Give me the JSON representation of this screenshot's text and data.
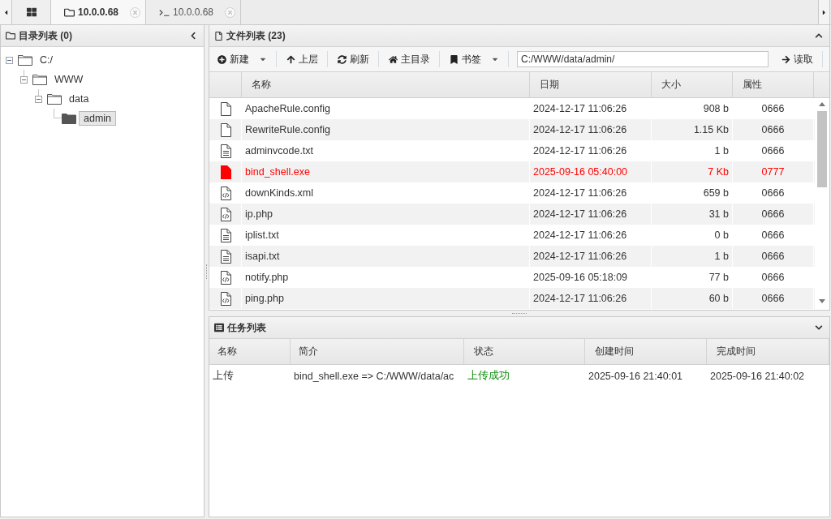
{
  "tabs": [
    {
      "label": "10.0.0.68",
      "kind": "files",
      "selected": true
    },
    {
      "label": "10.0.0.68",
      "kind": "terminal",
      "selected": false
    }
  ],
  "directory_panel": {
    "title": "目录列表 (0)",
    "tree": [
      {
        "label": "C:/",
        "expanded": true,
        "selected": false,
        "children": [
          {
            "label": "WWW",
            "expanded": true,
            "selected": false,
            "children": [
              {
                "label": "data",
                "expanded": true,
                "selected": false,
                "children": [
                  {
                    "label": "admin",
                    "selected": true
                  }
                ]
              }
            ]
          }
        ]
      }
    ]
  },
  "file_panel": {
    "title": "文件列表 (23)",
    "toolbar": [
      {
        "label": "新建",
        "kind": "new",
        "dropdown": true
      },
      {
        "label": "上层",
        "kind": "up",
        "dropdown": false
      },
      {
        "label": "刷新",
        "kind": "refresh",
        "dropdown": false
      },
      {
        "label": "主目录",
        "kind": "home",
        "dropdown": false
      },
      {
        "label": "书签",
        "kind": "bookmark",
        "dropdown": true
      }
    ],
    "path_field": {
      "value": "C:/WWW/data/admin/"
    },
    "read_button": {
      "label": "读取"
    },
    "table": {
      "columns": [
        "名称",
        "日期",
        "大小",
        "属性"
      ],
      "rows": [
        {
          "kind": "blank",
          "name": "ApacheRule.config",
          "date": "2024-12-17 11:06:26",
          "size": "908 b",
          "mode": "0666",
          "highlighted": false
        },
        {
          "kind": "blank",
          "name": "RewriteRule.config",
          "date": "2024-12-17 11:06:26",
          "size": "1.15 Kb",
          "mode": "0666",
          "highlighted": false
        },
        {
          "kind": "text",
          "name": "adminvcode.txt",
          "date": "2024-12-17 11:06:26",
          "size": "1 b",
          "mode": "0666",
          "highlighted": false
        },
        {
          "kind": "executable",
          "name": "bind_shell.exe",
          "date": "2025-09-16 05:40:00",
          "size": "7 Kb",
          "mode": "0777",
          "highlighted": true
        },
        {
          "kind": "code",
          "name": "downKinds.xml",
          "date": "2024-12-17 11:06:26",
          "size": "659 b",
          "mode": "0666",
          "highlighted": false
        },
        {
          "kind": "code",
          "name": "ip.php",
          "date": "2024-12-17 11:06:26",
          "size": "31 b",
          "mode": "0666",
          "highlighted": false
        },
        {
          "kind": "text",
          "name": "iplist.txt",
          "date": "2024-12-17 11:06:26",
          "size": "0 b",
          "mode": "0666",
          "highlighted": false
        },
        {
          "kind": "text",
          "name": "isapi.txt",
          "date": "2024-12-17 11:06:26",
          "size": "1 b",
          "mode": "0666",
          "highlighted": false
        },
        {
          "kind": "code",
          "name": "notify.php",
          "date": "2025-09-16 05:18:09",
          "size": "77 b",
          "mode": "0666",
          "highlighted": false
        },
        {
          "kind": "code",
          "name": "ping.php",
          "date": "2024-12-17 11:06:26",
          "size": "60 b",
          "mode": "0666",
          "highlighted": false
        }
      ]
    }
  },
  "task_panel": {
    "title": "任务列表",
    "table": {
      "columns": [
        "名称",
        "简介",
        "状态",
        "创建时间",
        "完成时间"
      ],
      "rows": [
        {
          "name": "上传",
          "description": "bind_shell.exe => C:/WWW/data/ac",
          "status": "上传成功",
          "succeeded": true,
          "created": "2025-09-16 21:40:01",
          "finished": "2025-09-16 21:40:02"
        }
      ]
    }
  }
}
